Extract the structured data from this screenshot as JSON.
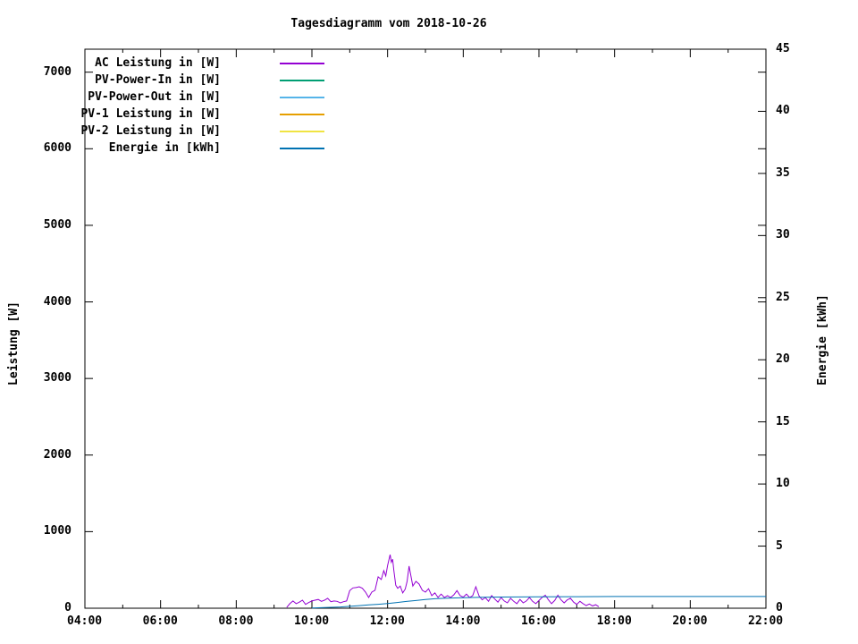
{
  "page": {
    "background": "#ffffff",
    "text_color": "#000000"
  },
  "chart_data": {
    "type": "line",
    "title": "Tagesdiagramm vom 2018-10-26",
    "xlabel": "",
    "ylabel": "Leistung [W]",
    "y2label": "Energie [kWh]",
    "x_major_tick_labels": [
      "04:00",
      "06:00",
      "08:00",
      "10:00",
      "12:00",
      "14:00",
      "16:00",
      "18:00",
      "20:00",
      "22:00"
    ],
    "x_minor_step_hours": 1,
    "xlim_hours": [
      4,
      22
    ],
    "ylim": [
      0,
      7300
    ],
    "y_ticks": [
      0,
      1000,
      2000,
      3000,
      4000,
      5000,
      6000,
      7000
    ],
    "y2lim": [
      0,
      45
    ],
    "y2_ticks": [
      0,
      5,
      10,
      15,
      20,
      25,
      30,
      35,
      40,
      45
    ],
    "grid": false,
    "legend_position": "top-left-inside",
    "series": [
      {
        "name": "AC Leistung in [W]",
        "color": "#9400d3",
        "axis": "y1",
        "points": [
          [
            "09:20",
            10
          ],
          [
            "09:25",
            60
          ],
          [
            "09:30",
            95
          ],
          [
            "09:35",
            60
          ],
          [
            "09:40",
            80
          ],
          [
            "09:45",
            105
          ],
          [
            "09:50",
            50
          ],
          [
            "09:55",
            75
          ],
          [
            "10:00",
            95
          ],
          [
            "10:05",
            105
          ],
          [
            "10:10",
            115
          ],
          [
            "10:15",
            90
          ],
          [
            "10:20",
            105
          ],
          [
            "10:25",
            130
          ],
          [
            "10:30",
            85
          ],
          [
            "10:35",
            95
          ],
          [
            "10:40",
            90
          ],
          [
            "10:45",
            70
          ],
          [
            "10:50",
            85
          ],
          [
            "10:55",
            95
          ],
          [
            "11:00",
            230
          ],
          [
            "11:05",
            265
          ],
          [
            "11:10",
            270
          ],
          [
            "11:15",
            280
          ],
          [
            "11:20",
            260
          ],
          [
            "11:25",
            210
          ],
          [
            "11:30",
            140
          ],
          [
            "11:35",
            210
          ],
          [
            "11:40",
            235
          ],
          [
            "11:45",
            410
          ],
          [
            "11:50",
            375
          ],
          [
            "11:54",
            490
          ],
          [
            "11:57",
            420
          ],
          [
            "12:00",
            560
          ],
          [
            "12:04",
            700
          ],
          [
            "12:06",
            600
          ],
          [
            "12:08",
            640
          ],
          [
            "12:10",
            490
          ],
          [
            "12:13",
            300
          ],
          [
            "12:16",
            260
          ],
          [
            "12:20",
            290
          ],
          [
            "12:24",
            200
          ],
          [
            "12:28",
            250
          ],
          [
            "12:31",
            350
          ],
          [
            "12:34",
            550
          ],
          [
            "12:37",
            420
          ],
          [
            "12:40",
            290
          ],
          [
            "12:45",
            350
          ],
          [
            "12:50",
            315
          ],
          [
            "12:55",
            235
          ],
          [
            "13:00",
            210
          ],
          [
            "13:05",
            255
          ],
          [
            "13:10",
            165
          ],
          [
            "13:15",
            200
          ],
          [
            "13:20",
            140
          ],
          [
            "13:25",
            185
          ],
          [
            "13:30",
            140
          ],
          [
            "13:35",
            165
          ],
          [
            "13:40",
            140
          ],
          [
            "13:45",
            175
          ],
          [
            "13:50",
            230
          ],
          [
            "13:55",
            165
          ],
          [
            "14:00",
            145
          ],
          [
            "14:05",
            185
          ],
          [
            "14:10",
            140
          ],
          [
            "14:15",
            165
          ],
          [
            "14:20",
            280
          ],
          [
            "14:25",
            160
          ],
          [
            "14:30",
            110
          ],
          [
            "14:35",
            140
          ],
          [
            "14:40",
            90
          ],
          [
            "14:45",
            165
          ],
          [
            "14:50",
            120
          ],
          [
            "14:55",
            80
          ],
          [
            "15:00",
            140
          ],
          [
            "15:05",
            95
          ],
          [
            "15:10",
            70
          ],
          [
            "15:15",
            130
          ],
          [
            "15:20",
            90
          ],
          [
            "15:25",
            60
          ],
          [
            "15:30",
            115
          ],
          [
            "15:35",
            70
          ],
          [
            "15:40",
            95
          ],
          [
            "15:45",
            140
          ],
          [
            "15:50",
            90
          ],
          [
            "15:55",
            60
          ],
          [
            "16:00",
            100
          ],
          [
            "16:05",
            140
          ],
          [
            "16:10",
            170
          ],
          [
            "16:15",
            110
          ],
          [
            "16:20",
            60
          ],
          [
            "16:25",
            100
          ],
          [
            "16:30",
            170
          ],
          [
            "16:35",
            110
          ],
          [
            "16:40",
            70
          ],
          [
            "16:45",
            110
          ],
          [
            "16:50",
            130
          ],
          [
            "16:55",
            80
          ],
          [
            "17:00",
            50
          ],
          [
            "17:05",
            90
          ],
          [
            "17:10",
            60
          ],
          [
            "17:15",
            35
          ],
          [
            "17:20",
            55
          ],
          [
            "17:25",
            30
          ],
          [
            "17:30",
            45
          ],
          [
            "17:35",
            20
          ]
        ]
      },
      {
        "name": "PV-Power-In in [W]",
        "color": "#009e73",
        "axis": "y1",
        "points": []
      },
      {
        "name": "PV-Power-Out in [W]",
        "color": "#56b4e9",
        "axis": "y1",
        "points": []
      },
      {
        "name": "PV-1 Leistung in [W]",
        "color": "#e69f00",
        "axis": "y1",
        "points": []
      },
      {
        "name": "PV-2 Leistung in [W]",
        "color": "#f0e442",
        "axis": "y1",
        "points": []
      },
      {
        "name": "Energie in [kWh]",
        "color": "#0072b2",
        "axis": "y2",
        "points": [
          [
            "10:00",
            0.02
          ],
          [
            "10:15",
            0.04
          ],
          [
            "10:30",
            0.07
          ],
          [
            "10:45",
            0.1
          ],
          [
            "11:00",
            0.15
          ],
          [
            "11:15",
            0.21
          ],
          [
            "11:30",
            0.27
          ],
          [
            "11:45",
            0.32
          ],
          [
            "12:00",
            0.38
          ],
          [
            "12:15",
            0.46
          ],
          [
            "12:30",
            0.55
          ],
          [
            "12:45",
            0.62
          ],
          [
            "13:00",
            0.7
          ],
          [
            "13:15",
            0.76
          ],
          [
            "13:30",
            0.8
          ],
          [
            "14:00",
            0.85
          ],
          [
            "14:30",
            0.88
          ],
          [
            "15:00",
            0.9
          ],
          [
            "16:00",
            0.92
          ],
          [
            "17:00",
            0.93
          ],
          [
            "18:00",
            0.94
          ],
          [
            "22:00",
            0.94
          ]
        ]
      }
    ]
  }
}
